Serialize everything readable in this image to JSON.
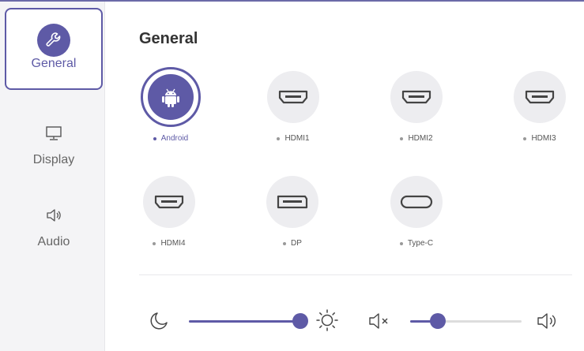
{
  "sidebar": {
    "items": [
      {
        "label": "General",
        "icon": "wrench-icon",
        "active": true
      },
      {
        "label": "Display",
        "icon": "monitor-icon",
        "active": false
      },
      {
        "label": "Audio",
        "icon": "speaker-icon",
        "active": false
      }
    ]
  },
  "main": {
    "title": "General",
    "sources": [
      {
        "label": "Android",
        "icon": "android-icon",
        "selected": true
      },
      {
        "label": "HDMI1",
        "icon": "hdmi-icon",
        "selected": false
      },
      {
        "label": "HDMI2",
        "icon": "hdmi-icon",
        "selected": false
      },
      {
        "label": "HDMI3",
        "icon": "hdmi-icon",
        "selected": false
      },
      {
        "label": "HDMI4",
        "icon": "hdmi-icon",
        "selected": false
      },
      {
        "label": "DP",
        "icon": "displayport-icon",
        "selected": false
      },
      {
        "label": "Type-C",
        "icon": "usb-c-icon",
        "selected": false
      }
    ]
  },
  "controls": {
    "brightness": {
      "min_icon": "moon-icon",
      "max_icon": "sun-icon",
      "level_percent": 100
    },
    "volume": {
      "min_icon": "mute-icon",
      "max_icon": "speaker-icon",
      "level_percent": 25
    }
  },
  "colors": {
    "accent": "#5e5aa6",
    "circle_bg": "#ededf0",
    "sidebar_bg": "#f4f4f6"
  }
}
